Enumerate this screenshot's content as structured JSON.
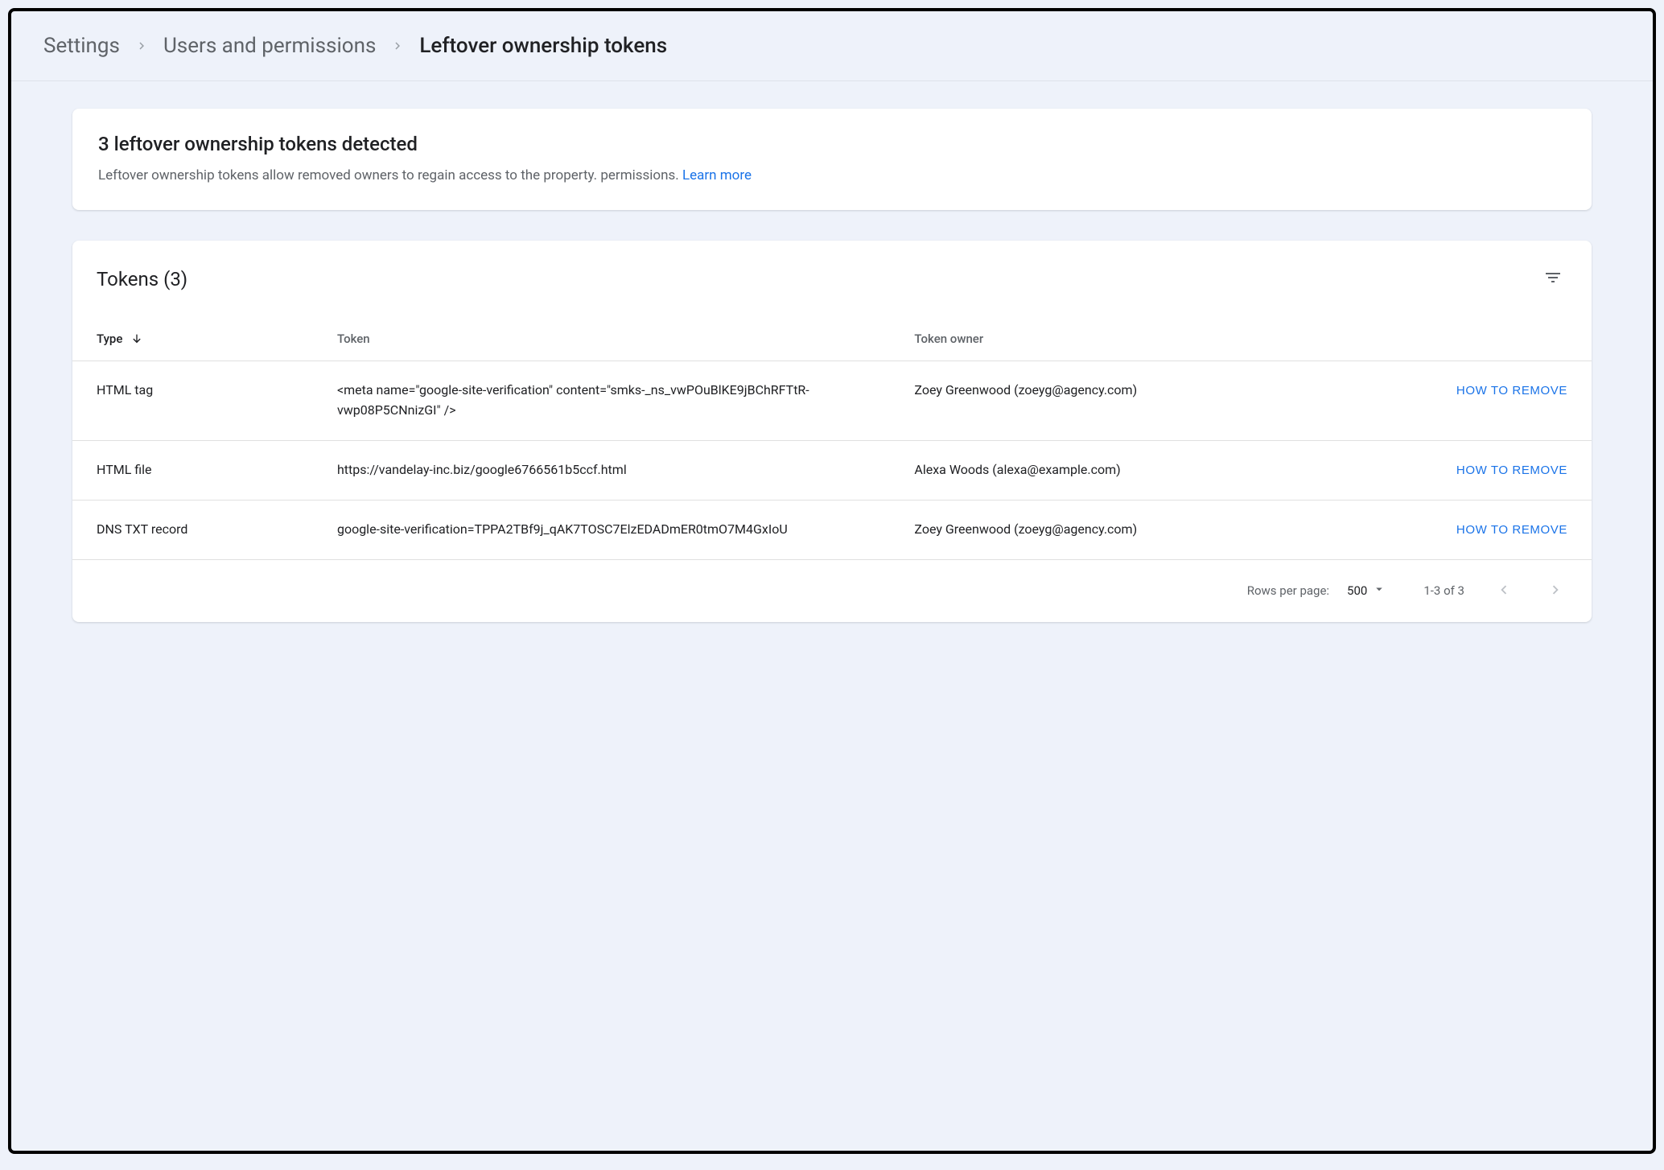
{
  "breadcrumb": {
    "settings": "Settings",
    "users": "Users and permissions",
    "current": "Leftover ownership tokens"
  },
  "banner": {
    "title": "3 leftover ownership tokens detected",
    "body": "Leftover ownership tokens allow removed owners to regain access to the property. permissions. ",
    "learn_more": "Learn more"
  },
  "table": {
    "title": "Tokens (3)",
    "columns": {
      "type": "Type",
      "token": "Token",
      "owner": "Token owner"
    },
    "action_label": "HOW TO REMOVE",
    "rows": [
      {
        "type": "HTML tag",
        "token": "<meta name=\"google-site-verification\" content=\"smks-_ns_vwPOuBlKE9jBChRFTtR-vwp08P5CNnizGI\" />",
        "owner": "Zoey Greenwood (zoeyg@agency.com)"
      },
      {
        "type": "HTML file",
        "token": "https://vandelay-inc.biz/google6766561b5ccf.html",
        "owner": "Alexa Woods (alexa@example.com)"
      },
      {
        "type": "DNS TXT record",
        "token": "google-site-verification=TPPA2TBf9j_qAK7TOSC7ElzEDADmER0tmO7M4GxIoU",
        "owner": "Zoey Greenwood (zoeyg@agency.com)"
      }
    ]
  },
  "pagination": {
    "rows_label": "Rows per page:",
    "rows_value": "500",
    "range": "1-3 of 3"
  }
}
